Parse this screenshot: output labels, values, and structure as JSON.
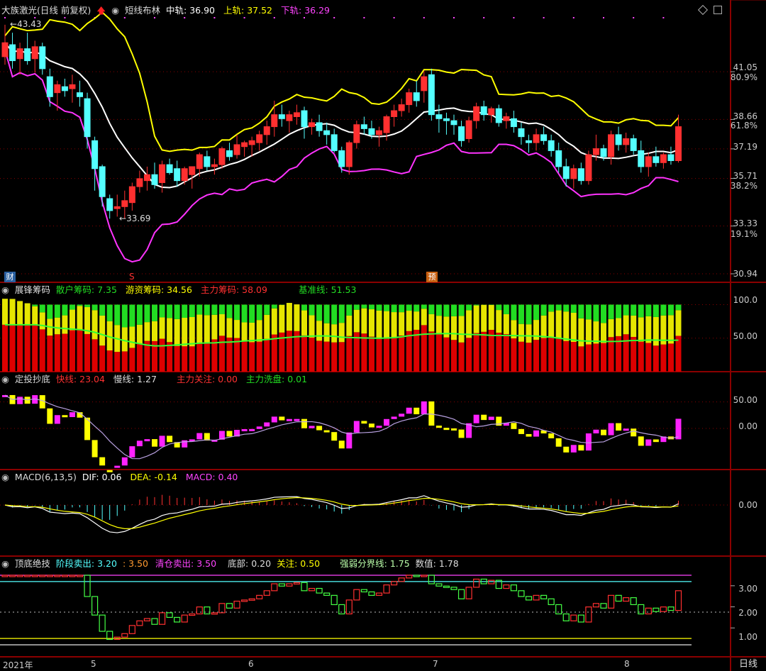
{
  "app": {
    "period_tab": "日线"
  },
  "colors": {
    "up": "#ff3030",
    "down": "#54ffff",
    "upper": "#ffff00",
    "mid": "#ffffff",
    "lower": "#ff33ff",
    "grid": "#8a0000",
    "green": "#22dd22",
    "yellow": "#e6e600"
  },
  "main": {
    "stock_name": "大族激光(日线 前复权)",
    "indicator": "短线布林",
    "mid_label": "中轨:",
    "mid_value": "36.90",
    "upper_label": "上轨:",
    "upper_value": "37.52",
    "lower_label": "下轨:",
    "lower_value": "36.29",
    "high_mark": "43.43",
    "low_mark": "33.69",
    "price_ticks": [
      "41.05",
      "38.66",
      "37.19",
      "35.71",
      "33.33",
      "30.94"
    ],
    "pct_ticks": [
      "80.9%",
      "61.8%",
      "38.2%",
      "19.1%"
    ],
    "badge_fin": "财",
    "badge_s": "S",
    "badge_pre": "预"
  },
  "chip": {
    "title": "展锋筹码",
    "retail_label": "散户筹码:",
    "retail_value": "7.35",
    "hot_label": "游资筹码:",
    "hot_value": "34.56",
    "main_label": "主力筹码:",
    "main_value": "58.09",
    "base_label": "基准线:",
    "base_value": "51.53",
    "ticks": [
      "100.0",
      "50.00"
    ]
  },
  "dip": {
    "title": "定投抄底",
    "fast_label": "快线:",
    "fast_value": "23.04",
    "slow_label": "慢线:",
    "slow_value": "1.27",
    "focus_label": "主力关注:",
    "focus_value": "0.00",
    "wash_label": "主力洗盘:",
    "wash_value": "0.01",
    "ticks": [
      "50.00",
      "0.00"
    ]
  },
  "macd": {
    "title": "MACD(6,13,5)",
    "dif_label": "DIF:",
    "dif_value": "0.06",
    "dea_label": "DEA:",
    "dea_value": "-0.14",
    "macd_label": "MACD:",
    "macd_value": "0.40",
    "ticks": [
      "0.00"
    ]
  },
  "top": {
    "title": "顶底绝技",
    "stage_label": "阶段卖出:",
    "stage_value": "3.20",
    "stage2_value": ": 3.50",
    "clear_label": "清仓卖出:",
    "clear_value": "3.50",
    "bottom_label": "底部:",
    "bottom_value": "0.20",
    "watch_label": "关注:",
    "watch_value": "0.50",
    "strong_label": "强弱分界线:",
    "strong_value": "1.75",
    "num_label": "数值:",
    "num_value": "1.78",
    "ticks": [
      "3.00",
      "2.00",
      "1.00"
    ]
  },
  "xaxis": {
    "labels": [
      "2021年",
      "5",
      "6",
      "7",
      "8"
    ]
  },
  "chart_data": {
    "type": "candlestick",
    "ylim": [
      30.94,
      43.43
    ],
    "ohlc": [
      [
        41.8,
        43.4,
        41.4,
        42.5
      ],
      [
        42.4,
        43.0,
        41.2,
        41.6
      ],
      [
        41.7,
        42.5,
        40.9,
        42.2
      ],
      [
        42.2,
        43.0,
        41.4,
        41.6
      ],
      [
        41.7,
        42.6,
        41.0,
        42.3
      ],
      [
        42.3,
        42.5,
        40.9,
        41.2
      ],
      [
        40.8,
        41.2,
        39.3,
        39.8
      ],
      [
        40.0,
        40.6,
        39.1,
        40.4
      ],
      [
        40.3,
        40.7,
        39.8,
        40.1
      ],
      [
        40.2,
        40.9,
        39.5,
        40.4
      ],
      [
        40.0,
        40.6,
        39.3,
        39.8
      ],
      [
        39.7,
        40.0,
        37.2,
        37.8
      ],
      [
        37.6,
        37.8,
        35.1,
        36.2
      ],
      [
        36.3,
        36.4,
        34.3,
        34.8
      ],
      [
        34.7,
        34.9,
        33.7,
        34.1
      ],
      [
        34.2,
        34.9,
        33.8,
        34.3
      ],
      [
        34.3,
        35.1,
        33.7,
        34.6
      ],
      [
        34.5,
        35.5,
        34.1,
        35.3
      ],
      [
        35.3,
        36.1,
        35.0,
        35.7
      ],
      [
        35.6,
        36.3,
        35.1,
        35.9
      ],
      [
        35.9,
        36.5,
        35.2,
        35.4
      ],
      [
        35.5,
        36.6,
        35.0,
        36.4
      ],
      [
        36.4,
        36.7,
        35.9,
        36.0
      ],
      [
        36.2,
        36.6,
        35.3,
        35.6
      ],
      [
        35.6,
        36.3,
        35.4,
        36.2
      ],
      [
        35.9,
        36.1,
        35.2,
        36.3
      ],
      [
        36.2,
        37.0,
        35.8,
        36.9
      ],
      [
        36.8,
        37.1,
        36.1,
        36.3
      ],
      [
        36.3,
        36.7,
        35.9,
        36.4
      ],
      [
        36.4,
        37.3,
        36.2,
        37.2
      ],
      [
        37.1,
        37.5,
        36.6,
        36.8
      ],
      [
        36.9,
        37.9,
        36.7,
        37.4
      ],
      [
        37.3,
        37.6,
        36.8,
        37.5
      ],
      [
        37.4,
        37.8,
        36.8,
        37.6
      ],
      [
        37.5,
        38.1,
        37.1,
        37.9
      ],
      [
        37.9,
        38.6,
        37.4,
        38.3
      ],
      [
        38.3,
        39.6,
        37.8,
        38.9
      ],
      [
        38.9,
        39.4,
        38.3,
        38.7
      ],
      [
        38.6,
        39.1,
        38.0,
        38.9
      ],
      [
        38.8,
        39.4,
        38.4,
        39.0
      ],
      [
        39.1,
        39.3,
        37.7,
        38.3
      ],
      [
        38.3,
        38.7,
        37.9,
        38.5
      ],
      [
        38.5,
        38.9,
        37.8,
        38.1
      ],
      [
        38.1,
        38.5,
        37.4,
        37.9
      ],
      [
        37.9,
        38.2,
        37.0,
        37.1
      ],
      [
        37.1,
        37.3,
        36.0,
        36.3
      ],
      [
        36.3,
        37.6,
        35.9,
        37.5
      ],
      [
        37.5,
        38.6,
        37.2,
        38.4
      ],
      [
        38.4,
        38.8,
        37.9,
        38.2
      ],
      [
        38.2,
        38.6,
        37.7,
        37.9
      ],
      [
        37.9,
        38.3,
        37.3,
        38.1
      ],
      [
        38.0,
        38.9,
        37.6,
        38.8
      ],
      [
        38.8,
        39.4,
        38.3,
        39.1
      ],
      [
        39.1,
        39.7,
        38.8,
        39.4
      ],
      [
        39.4,
        40.2,
        39.0,
        40.0
      ],
      [
        40.0,
        40.6,
        39.3,
        39.6
      ],
      [
        40.1,
        41.1,
        39.5,
        40.8
      ],
      [
        40.9,
        41.2,
        38.6,
        38.9
      ],
      [
        38.9,
        39.4,
        38.0,
        38.7
      ],
      [
        38.7,
        39.0,
        37.9,
        38.6
      ],
      [
        38.6,
        38.9,
        37.9,
        38.4
      ],
      [
        38.3,
        38.6,
        37.3,
        37.6
      ],
      [
        37.7,
        38.8,
        37.5,
        38.6
      ],
      [
        38.6,
        39.5,
        38.2,
        39.3
      ],
      [
        39.3,
        39.6,
        38.6,
        38.9
      ],
      [
        38.9,
        39.3,
        38.5,
        39.2
      ],
      [
        39.2,
        39.4,
        38.3,
        38.5
      ],
      [
        38.6,
        39.0,
        38.2,
        38.8
      ],
      [
        38.7,
        39.1,
        38.0,
        38.3
      ],
      [
        38.2,
        38.5,
        37.4,
        37.8
      ],
      [
        37.6,
        37.9,
        37.0,
        37.5
      ],
      [
        37.5,
        38.2,
        37.1,
        37.9
      ],
      [
        37.9,
        38.3,
        37.4,
        37.6
      ],
      [
        37.6,
        37.9,
        36.8,
        37.1
      ],
      [
        37.1,
        37.5,
        36.0,
        36.3
      ],
      [
        36.3,
        36.7,
        35.3,
        35.7
      ],
      [
        35.7,
        36.4,
        35.2,
        36.2
      ],
      [
        36.2,
        36.5,
        35.4,
        35.6
      ],
      [
        35.6,
        37.1,
        35.4,
        36.9
      ],
      [
        36.9,
        37.9,
        36.6,
        37.2
      ],
      [
        37.2,
        37.4,
        36.6,
        36.8
      ],
      [
        36.8,
        38.1,
        36.4,
        37.9
      ],
      [
        37.9,
        38.3,
        37.1,
        37.4
      ],
      [
        37.4,
        38.0,
        37.0,
        37.7
      ],
      [
        37.7,
        37.9,
        36.9,
        37.1
      ],
      [
        37.1,
        37.6,
        36.0,
        36.3
      ],
      [
        36.3,
        37.0,
        35.8,
        36.8
      ],
      [
        36.8,
        37.3,
        36.3,
        36.5
      ],
      [
        36.5,
        37.0,
        36.2,
        36.9
      ],
      [
        36.9,
        37.3,
        36.4,
        36.6
      ],
      [
        36.6,
        38.9,
        36.5,
        38.3
      ]
    ]
  }
}
